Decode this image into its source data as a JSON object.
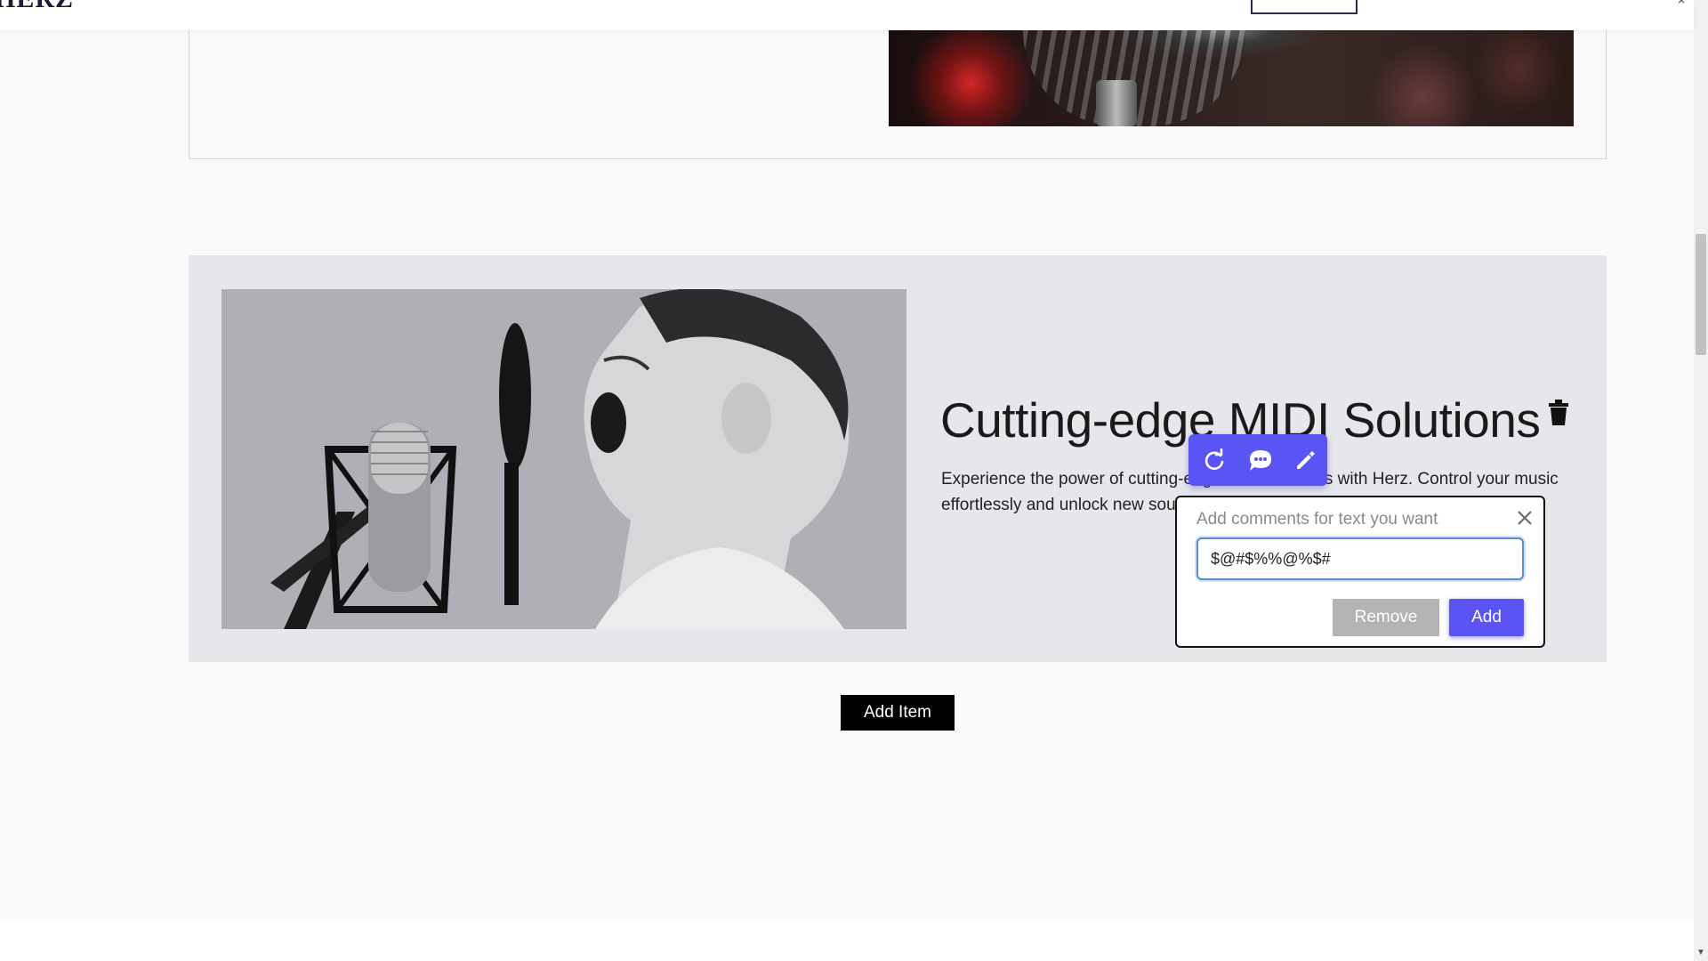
{
  "header": {
    "brand": "HERZ"
  },
  "feature": {
    "title": "Cutting-edge MIDI Solutions",
    "description": "Experience the power of cutting-edge MIDI solutions with Herz. Control your music effortlessly and unlock new sounds.",
    "image_alt": "Boy singing into a studio microphone"
  },
  "toolbar": {
    "refresh_icon": "refresh-icon",
    "comment_icon": "comment-icon",
    "edit_icon": "pencil-icon"
  },
  "comment_popup": {
    "title": "Add comments for text you want",
    "input_value": "$@#$%%@%$#",
    "remove_label": "Remove",
    "add_label": "Add"
  },
  "actions": {
    "add_item_label": "Add Item"
  },
  "colors": {
    "accent": "#5b54f5",
    "section_bg": "#e5e7eb",
    "page_bg": "#fafafa"
  }
}
